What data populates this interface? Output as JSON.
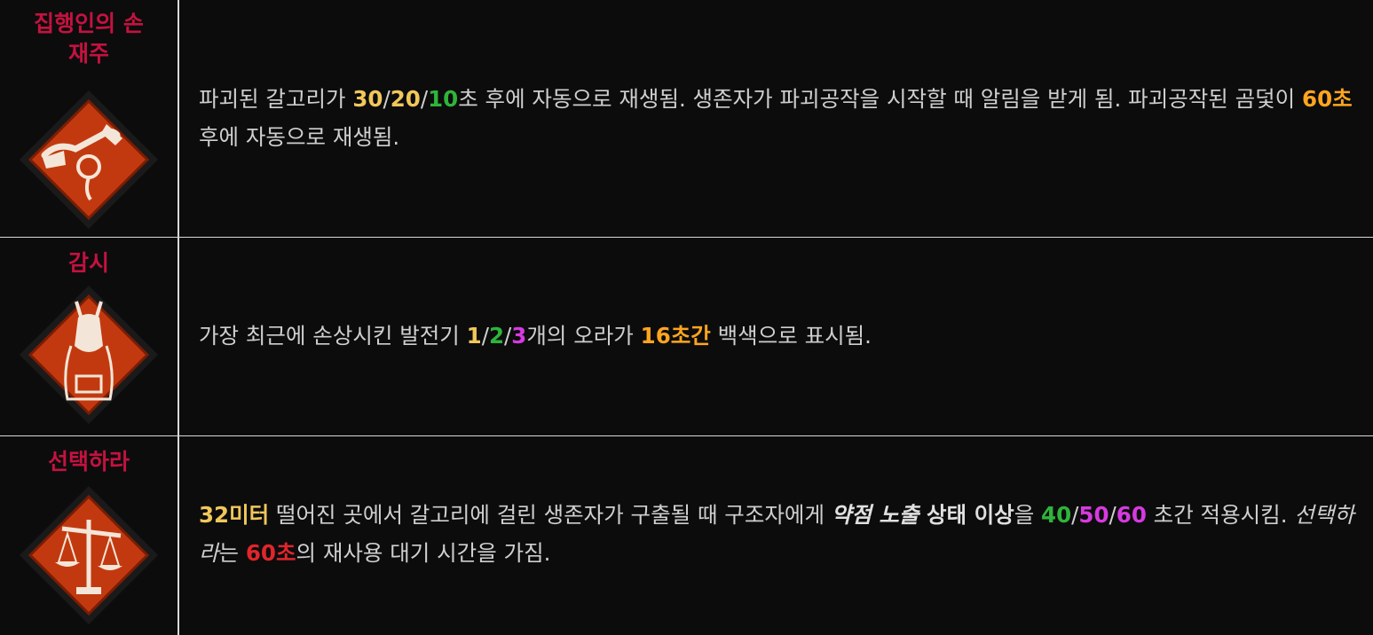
{
  "colors": {
    "perk_name": "#c4123f",
    "text": "#cfcfcf",
    "yellow": "#f1c75a",
    "green": "#2fb43a",
    "purple": "#d63ae0",
    "orange": "#ffa51f",
    "red": "#e0262a",
    "divider": "#d9d9d9",
    "background": "#0c0c0d",
    "icon_fill": "#c3390f"
  },
  "perks": [
    {
      "name": "집행인의 손\n재주",
      "icon": "hangmans-trick-icon",
      "desc": {
        "t1": "파괴된 갈고리가 ",
        "v1": "30",
        "s1": "/",
        "v2": "20",
        "s2": "/",
        "v3": "10",
        "t2": "초 후에 자동으로 재생됨. 생존자가 파괴공작을 시작할 때 알림을 받게 됨. 파괴공작된 곰덫이 ",
        "v4": "60초",
        "t3": " 후에 자동으로 재생됨."
      }
    },
    {
      "name": "감시",
      "icon": "surveillance-icon",
      "desc": {
        "t1": "가장 최근에 손상시킨 발전기 ",
        "v1": "1",
        "s1": "/",
        "v2": "2",
        "s2": "/",
        "v3": "3",
        "t2": "개의 오라가 ",
        "v4": "16초간",
        "t3": " 백색으로 표시됨."
      }
    },
    {
      "name": "선택하라",
      "icon": "make-your-choice-icon",
      "desc": {
        "v0": "32미터",
        "t1": " 떨어진 곳에서 갈고리에 걸린 생존자가 구출될 때 구조자에게 ",
        "e1": "약점 노출",
        "e2": " 상태 이상",
        "t2": "을 ",
        "v1": "40",
        "s1": "/",
        "v2": "50",
        "s2": "/",
        "v3": "60",
        "t3": " 초간 적용시킴. ",
        "it": "선택하라",
        "t4": "는 ",
        "v4": "60초",
        "t5": "의 재사용 대기 시간을 가짐."
      }
    }
  ]
}
